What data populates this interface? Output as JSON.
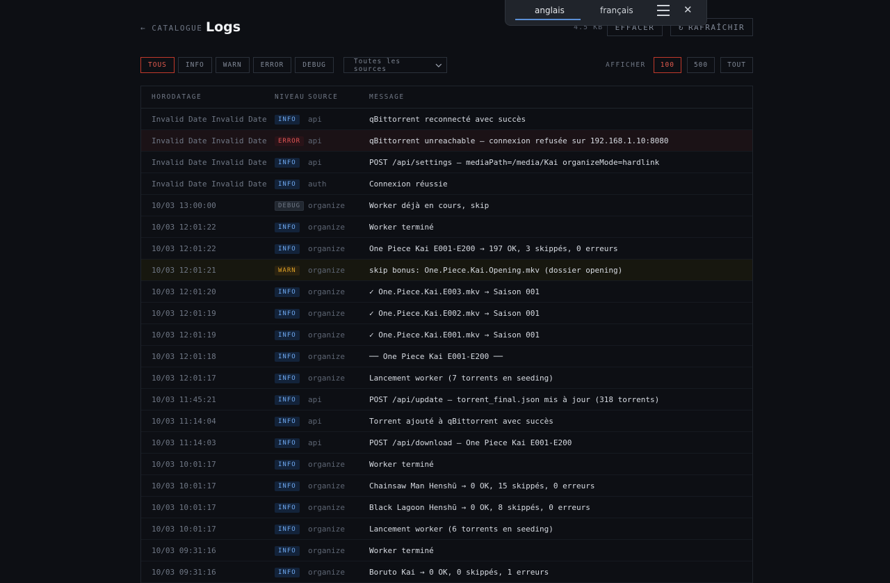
{
  "header": {
    "back_label": "← CATALOGUE",
    "title": "Logs",
    "size": "4.5 KB",
    "clear_label": "EFFACER",
    "refresh_label": "RAFRAÎCHIR",
    "refresh_icon": "↻"
  },
  "filters": {
    "levels": [
      "TOUS",
      "INFO",
      "WARN",
      "ERROR",
      "DEBUG"
    ],
    "active_level": "TOUS",
    "source_select": "Toutes les sources"
  },
  "show": {
    "label": "AFFICHER",
    "options": [
      "100",
      "500",
      "TOUT"
    ],
    "active": "100"
  },
  "table": {
    "columns": [
      "HORODATAGE",
      "NIVEAU",
      "SOURCE",
      "MESSAGE"
    ],
    "rows": [
      {
        "time": "Invalid Date Invalid Date",
        "level": "INFO",
        "source": "api",
        "message": "qBittorrent reconnecté avec succès"
      },
      {
        "time": "Invalid Date Invalid Date",
        "level": "ERROR",
        "source": "api",
        "message": "qBittorrent unreachable — connexion refusée sur 192.168.1.10:8080"
      },
      {
        "time": "Invalid Date Invalid Date",
        "level": "INFO",
        "source": "api",
        "message": "POST /api/settings — mediaPath=/media/Kai organizeMode=hardlink"
      },
      {
        "time": "Invalid Date Invalid Date",
        "level": "INFO",
        "source": "auth",
        "message": "Connexion réussie"
      },
      {
        "time": "10/03 13:00:00",
        "level": "DEBUG",
        "source": "organize",
        "message": "Worker déjà en cours, skip"
      },
      {
        "time": "10/03 12:01:22",
        "level": "INFO",
        "source": "organize",
        "message": "Worker terminé"
      },
      {
        "time": "10/03 12:01:22",
        "level": "INFO",
        "source": "organize",
        "message": "One Piece Kai E001-E200 → 197 OK, 3 skippés, 0 erreurs"
      },
      {
        "time": "10/03 12:01:21",
        "level": "WARN",
        "source": "organize",
        "message": "skip bonus: One.Piece.Kai.Opening.mkv (dossier opening)"
      },
      {
        "time": "10/03 12:01:20",
        "level": "INFO",
        "source": "organize",
        "message": "✓ One.Piece.Kai.E003.mkv → Saison 001"
      },
      {
        "time": "10/03 12:01:19",
        "level": "INFO",
        "source": "organize",
        "message": "✓ One.Piece.Kai.E002.mkv → Saison 001"
      },
      {
        "time": "10/03 12:01:19",
        "level": "INFO",
        "source": "organize",
        "message": "✓ One.Piece.Kai.E001.mkv → Saison 001"
      },
      {
        "time": "10/03 12:01:18",
        "level": "INFO",
        "source": "organize",
        "message": "── One Piece Kai E001-E200 ──"
      },
      {
        "time": "10/03 12:01:17",
        "level": "INFO",
        "source": "organize",
        "message": "Lancement worker (7 torrents en seeding)"
      },
      {
        "time": "10/03 11:45:21",
        "level": "INFO",
        "source": "api",
        "message": "POST /api/update — torrent_final.json mis à jour (318 torrents)"
      },
      {
        "time": "10/03 11:14:04",
        "level": "INFO",
        "source": "api",
        "message": "Torrent ajouté à qBittorrent avec succès"
      },
      {
        "time": "10/03 11:14:03",
        "level": "INFO",
        "source": "api",
        "message": "POST /api/download — One Piece Kai E001-E200"
      },
      {
        "time": "10/03 10:01:17",
        "level": "INFO",
        "source": "organize",
        "message": "Worker terminé"
      },
      {
        "time": "10/03 10:01:17",
        "level": "INFO",
        "source": "organize",
        "message": "Chainsaw Man Henshū → 0 OK, 15 skippés, 0 erreurs"
      },
      {
        "time": "10/03 10:01:17",
        "level": "INFO",
        "source": "organize",
        "message": "Black Lagoon Henshū → 0 OK, 8 skippés, 0 erreurs"
      },
      {
        "time": "10/03 10:01:17",
        "level": "INFO",
        "source": "organize",
        "message": "Lancement worker (6 torrents en seeding)"
      },
      {
        "time": "10/03 09:31:16",
        "level": "INFO",
        "source": "organize",
        "message": "Worker terminé"
      },
      {
        "time": "10/03 09:31:16",
        "level": "INFO",
        "source": "organize",
        "message": "Boruto Kai → 0 OK, 0 skippés, 1 erreurs"
      }
    ]
  },
  "translate_bar": {
    "lang_a": "anglais",
    "lang_b": "français",
    "menu_icon": "hamburger-icon",
    "close_glyph": "✕"
  },
  "colors": {
    "background": "#0d0f14",
    "accent": "#e35a4e",
    "info": "#6ea8f0",
    "error": "#e25555",
    "warn": "#e0a326"
  }
}
